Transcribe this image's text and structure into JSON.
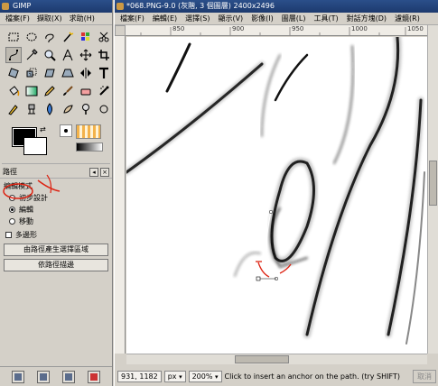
{
  "toolbox": {
    "title": "GIMP",
    "menu": [
      "檔案(F)",
      "擷取(X)",
      "求助(H)"
    ],
    "tools": [
      "rect-select-icon",
      "ellipse-select-icon",
      "lasso-icon",
      "fuzzy-select-icon",
      "color-select-icon",
      "scissors-icon",
      "paths-icon",
      "color-picker-icon",
      "zoom-icon",
      "measure-icon",
      "move-icon",
      "crop-icon",
      "rotate-icon",
      "scale-icon",
      "shear-icon",
      "perspective-icon",
      "flip-icon",
      "text-icon",
      "bucket-fill-icon",
      "blend-icon",
      "pencil-icon",
      "paintbrush-icon",
      "eraser-icon",
      "airbrush-icon",
      "ink-icon",
      "clone-icon",
      "convolve-icon",
      "smudge-icon",
      "dodge-icon",
      "unknown-icon"
    ],
    "swap_glyph": "⇄"
  },
  "paths_dock": {
    "title": "路徑",
    "mode_label": "編輯模式",
    "modes": [
      "初步設計",
      "編輯",
      "移動"
    ],
    "selected_mode": "編輯",
    "polygon_label": "多邊形",
    "btn_selection": "由路徑產生選擇區域",
    "btn_stroke": "依路徑描邊"
  },
  "image_window": {
    "title": "*068.PNG-9.0 (灰階, 3 個圖層) 2400x2496",
    "menu": [
      "檔案(F)",
      "編輯(E)",
      "選擇(S)",
      "顯示(V)",
      "影像(I)",
      "圖層(L)",
      "工具(T)",
      "對話方塊(D)",
      "濾鏡(R)"
    ],
    "ruler_labels": [
      "850",
      "900",
      "950",
      "1000",
      "1050"
    ],
    "status": {
      "coords": "931, 1182",
      "unit": "px",
      "zoom": "200%",
      "message": "Click to insert an anchor on the path. (try SHIFT)",
      "cancel": "取消"
    }
  }
}
